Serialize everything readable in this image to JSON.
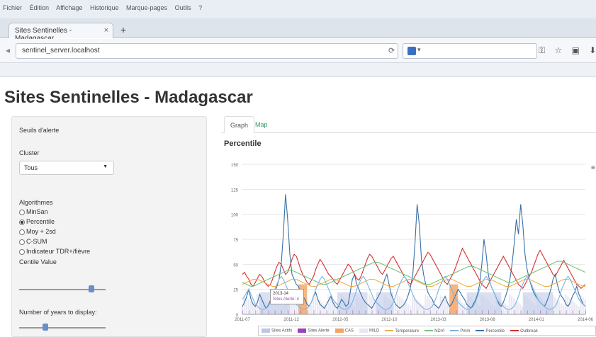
{
  "browser": {
    "menu": [
      "Fichier",
      "Édition",
      "Affichage",
      "Historique",
      "Marque-pages",
      "Outils",
      "?"
    ],
    "tab_title": "Sites Sentinelles - Madagascar",
    "new_tab_symbol": "+",
    "url": "sentinel_server.localhost"
  },
  "page": {
    "title": "Sites Sentinelles - Madagascar"
  },
  "sidebar": {
    "seuils_label": "Seuils d'alerte",
    "cluster_label": "Cluster",
    "cluster_value": "Tous",
    "algo_label": "Algorithmes",
    "algorithms": [
      {
        "label": "MinSan",
        "selected": false
      },
      {
        "label": "Percentile",
        "selected": true
      },
      {
        "label": "Moy + 2sd",
        "selected": false
      },
      {
        "label": "C-SUM",
        "selected": false
      },
      {
        "label": "Indicateur TDR+/fièvre",
        "selected": false
      }
    ],
    "centile_label": "Centile Value",
    "centile_level": 0.84,
    "years_label": "Number of years to display:",
    "years_level": 0.3
  },
  "main": {
    "tabs": [
      "Graph",
      "Map"
    ],
    "chart_title": "Percentile",
    "menu_icon": "≡",
    "tooltip_line1": "2013-14",
    "tooltip_line2": "Sites Alerte: 4"
  },
  "colors": {
    "sites_actifs": "#bcc6e6",
    "sites_alerte": "#a040b8",
    "cas": "#f4a460",
    "mild": "#e8e8f4",
    "temperature": "#f0b048",
    "ndvi": "#79c27e",
    "pmm": "#7ab4e0",
    "percentile": "#3a6fa8",
    "outbreak": "#d62f2f"
  },
  "chart_data": {
    "type": "line",
    "title": "Percentile",
    "x_ticks": [
      "2011-07",
      "2011-12",
      "2012-05",
      "2012-10",
      "2013-03",
      "2013-08",
      "2014-01",
      "2014-06"
    ],
    "ylim": [
      0,
      150
    ],
    "y_ticks": [
      "0",
      "25",
      "50",
      "75",
      "100",
      "125",
      "150"
    ],
    "n_weeks": 160,
    "legend": [
      "Sites Actifs",
      "Sites Alerte",
      "CAS",
      "MILD",
      "Temperature",
      "NDVI",
      "Pmm",
      "Percentile",
      "Outbreak"
    ],
    "series": [
      {
        "name": "Percentile",
        "values": [
          8,
          12,
          18,
          25,
          15,
          10,
          8,
          12,
          20,
          15,
          10,
          6,
          9,
          14,
          18,
          22,
          28,
          35,
          50,
          80,
          120,
          95,
          60,
          40,
          35,
          30,
          28,
          22,
          18,
          15,
          10,
          8,
          12,
          18,
          22,
          15,
          10,
          8,
          6,
          10,
          14,
          18,
          12,
          8,
          6,
          10,
          15,
          12,
          8,
          10,
          22,
          35,
          40,
          30,
          25,
          20,
          15,
          12,
          10,
          8,
          6,
          10,
          14,
          18,
          22,
          28,
          35,
          40,
          30,
          20,
          15,
          10,
          8,
          6,
          8,
          10,
          14,
          20,
          28,
          40,
          70,
          110,
          90,
          55,
          40,
          30,
          22,
          18,
          15,
          10,
          8,
          6,
          10,
          14,
          18,
          12,
          8,
          10,
          15,
          20,
          25,
          22,
          18,
          15,
          10,
          8,
          6,
          10,
          14,
          20,
          30,
          50,
          75,
          60,
          40,
          30,
          25,
          20,
          15,
          10,
          8,
          12,
          18,
          25,
          35,
          50,
          70,
          95,
          80,
          110,
          90,
          60,
          45,
          35,
          28,
          22,
          18,
          15,
          12,
          10,
          8,
          12,
          18,
          25,
          35,
          40,
          30,
          22,
          18,
          15,
          10,
          8,
          12,
          18,
          22,
          28,
          20,
          15,
          10,
          8
        ]
      },
      {
        "name": "Outbreak",
        "values": [
          40,
          42,
          38,
          35,
          30,
          28,
          32,
          36,
          40,
          38,
          34,
          30,
          28,
          30,
          35,
          42,
          48,
          52,
          50,
          45,
          40,
          42,
          48,
          55,
          60,
          58,
          52,
          45,
          40,
          36,
          32,
          30,
          34,
          38,
          45,
          50,
          55,
          52,
          48,
          44,
          40,
          38,
          35,
          32,
          30,
          34,
          38,
          42,
          46,
          50,
          48,
          44,
          40,
          36,
          34,
          38,
          44,
          50,
          56,
          60,
          58,
          54,
          50,
          46,
          42,
          40,
          44,
          48,
          52,
          56,
          58,
          54,
          50,
          46,
          42,
          38,
          35,
          32,
          30,
          34,
          38,
          42,
          46,
          50,
          54,
          58,
          62,
          60,
          56,
          52,
          48,
          44,
          40,
          36,
          32,
          30,
          34,
          38,
          42,
          48,
          54,
          60,
          66,
          62,
          58,
          54,
          50,
          46,
          42,
          38,
          34,
          30,
          28,
          26,
          30,
          34,
          38,
          42,
          46,
          50,
          54,
          58,
          54,
          50,
          46,
          42,
          38,
          34,
          30,
          28,
          26,
          30,
          34,
          38,
          42,
          48,
          54,
          60,
          64,
          60,
          56,
          52,
          48,
          44,
          40,
          38,
          42,
          46,
          50,
          54,
          50,
          46,
          42,
          38,
          34,
          30,
          28,
          26,
          28,
          30
        ]
      },
      {
        "name": "NDVI",
        "values": [
          32,
          31,
          30,
          29,
          28,
          28,
          29,
          30,
          31,
          32,
          33,
          34,
          35,
          36,
          37,
          38,
          39,
          40,
          41,
          42,
          43,
          44,
          44,
          44,
          43,
          42,
          41,
          40,
          39,
          38,
          37,
          36,
          35,
          34,
          33,
          32,
          31,
          30,
          30,
          30,
          31,
          32,
          33,
          34,
          35,
          36,
          37,
          38,
          39,
          40,
          41,
          42,
          43,
          44,
          45,
          46,
          47,
          48,
          49,
          50,
          51,
          52,
          52,
          52,
          51,
          50,
          49,
          48,
          47,
          46,
          45,
          44,
          43,
          42,
          41,
          40,
          39,
          38,
          37,
          36,
          35,
          34,
          33,
          32,
          31,
          30,
          30,
          30,
          31,
          32,
          33,
          34,
          35,
          36,
          37,
          38,
          39,
          40,
          41,
          42,
          43,
          44,
          45,
          46,
          47,
          48,
          48,
          48,
          47,
          46,
          45,
          44,
          43,
          42,
          41,
          40,
          39,
          38,
          37,
          36,
          35,
          34,
          33,
          32,
          32,
          32,
          33,
          34,
          35,
          36,
          37,
          38,
          39,
          40,
          41,
          42,
          43,
          44,
          45,
          46,
          47,
          48,
          49,
          50,
          51,
          52,
          53,
          53,
          53,
          52,
          51,
          50,
          49,
          48,
          47,
          46,
          45,
          44,
          43,
          42
        ]
      },
      {
        "name": "Temperature",
        "values": [
          30,
          31,
          32,
          33,
          34,
          35,
          35,
          35,
          34,
          33,
          32,
          31,
          30,
          29,
          28,
          28,
          28,
          29,
          30,
          31,
          32,
          33,
          34,
          35,
          35,
          35,
          34,
          33,
          32,
          31,
          30,
          29,
          28,
          28,
          28,
          29,
          30,
          31,
          32,
          33,
          34,
          35,
          35,
          35,
          34,
          33,
          32,
          31,
          30,
          29,
          28,
          28,
          28,
          29,
          30,
          31,
          32,
          33,
          34,
          35,
          35,
          35,
          34,
          33,
          32,
          31,
          30,
          29,
          28,
          28,
          28,
          29,
          30,
          31,
          32,
          33,
          34,
          35,
          35,
          35,
          34,
          33,
          32,
          31,
          30,
          29,
          28,
          28,
          28,
          29,
          30,
          31,
          32,
          33,
          34,
          35,
          35,
          35,
          34,
          33,
          32,
          31,
          30,
          29,
          28,
          28,
          28,
          29,
          30,
          31,
          32,
          33,
          34,
          35,
          35,
          35,
          34,
          33,
          32,
          31,
          30,
          29,
          28,
          28,
          28,
          29,
          30,
          31,
          32,
          33,
          34,
          35,
          35,
          35,
          34,
          33,
          32,
          31,
          30,
          29,
          28,
          28,
          28,
          29,
          30,
          31,
          32,
          33,
          34,
          35,
          35,
          35,
          34,
          33,
          32,
          31,
          30,
          29,
          28,
          28
        ]
      },
      {
        "name": "Pmm",
        "values": [
          15,
          18,
          22,
          25,
          20,
          15,
          10,
          8,
          6,
          5,
          5,
          6,
          8,
          12,
          18,
          25,
          30,
          35,
          38,
          35,
          30,
          25,
          20,
          15,
          12,
          10,
          8,
          6,
          5,
          5,
          6,
          8,
          12,
          18,
          25,
          30,
          35,
          38,
          35,
          30,
          25,
          20,
          15,
          12,
          10,
          8,
          6,
          5,
          5,
          6,
          8,
          12,
          18,
          25,
          30,
          35,
          38,
          35,
          30,
          25,
          20,
          15,
          12,
          10,
          8,
          6,
          5,
          5,
          6,
          8,
          12,
          18,
          25,
          30,
          35,
          38,
          35,
          30,
          25,
          20,
          15,
          12,
          10,
          8,
          6,
          5,
          5,
          6,
          8,
          12,
          18,
          25,
          30,
          35,
          38,
          35,
          30,
          25,
          20,
          15,
          12,
          10,
          8,
          6,
          5,
          5,
          6,
          8,
          12,
          18,
          25,
          30,
          35,
          38,
          35,
          30,
          25,
          20,
          15,
          12,
          10,
          8,
          6,
          5,
          5,
          6,
          8,
          12,
          18,
          25,
          30,
          35,
          38,
          35,
          30,
          25,
          20,
          15,
          12,
          10,
          8,
          6,
          5,
          5,
          6,
          8,
          12,
          18,
          25,
          30,
          35,
          38,
          35,
          30,
          25,
          20,
          15,
          12,
          10,
          8
        ]
      }
    ]
  }
}
